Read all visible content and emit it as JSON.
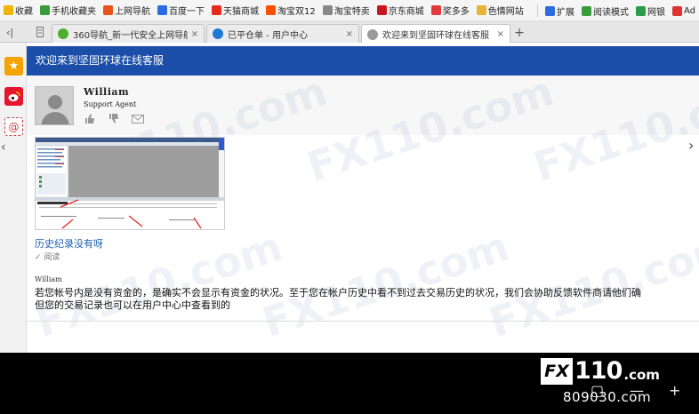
{
  "bookmarks": [
    {
      "label": "收藏",
      "icon": "star-icon",
      "color": "#f0b400"
    },
    {
      "label": "手机收藏夹",
      "icon": "phone-icon",
      "color": "#3a9b3a"
    },
    {
      "label": "上网导航",
      "icon": "nav-icon",
      "color": "#e8531a"
    },
    {
      "label": "百度一下",
      "icon": "baidu-icon",
      "color": "#2d6be0"
    },
    {
      "label": "天猫商城",
      "icon": "tmall-icon",
      "color": "#e62b1e"
    },
    {
      "label": "淘宝双12",
      "icon": "taobao-icon",
      "color": "#ff5000"
    },
    {
      "label": "淘宝特卖",
      "icon": "page-icon",
      "color": "#888888"
    },
    {
      "label": "京东商城",
      "icon": "jd-icon",
      "color": "#c91623"
    },
    {
      "label": "奖多多",
      "icon": "gift-icon",
      "color": "#e23a3a"
    },
    {
      "label": "色情网站",
      "icon": "folder-icon",
      "color": "#e8b339"
    }
  ],
  "bookmarks_more": "»",
  "toolbar_right": [
    {
      "label": "扩展",
      "icon": "grid-icon",
      "color": "#2d6be0"
    },
    {
      "label": "阅读模式",
      "icon": "book-icon",
      "color": "#3a9b3a"
    },
    {
      "label": "网银",
      "icon": "bank-icon",
      "color": "#2d9b4a"
    },
    {
      "label": "Ad",
      "icon": "ad-icon",
      "color": "#d33"
    }
  ],
  "tabs": [
    {
      "title": "360导航_新一代安全上网导航",
      "icon": "360-icon",
      "color": "#4cae2a",
      "active": false
    },
    {
      "title": "已平仓单 - 用户中心",
      "icon": "refresh-icon",
      "color": "#1f7ad6",
      "active": false
    },
    {
      "title": "欢迎来到坚固环球在线客服",
      "icon": "page-icon",
      "color": "#9a9a9a",
      "active": true
    }
  ],
  "tab_close": "×",
  "tab_add": "+",
  "tab_back": "‹|",
  "page": {
    "header_title": "欢迎来到坚固环球在线客服",
    "agent_name": "William",
    "agent_role": "Support Agent",
    "message_title": "历史纪录没有呀",
    "read_status": "✓ 阅读",
    "reply_author": "William",
    "reply_lines": [
      "若您帐号内是没有资金的，是确实不会显示有资金的状况。至于您在帐户历史中看不到过去交易历史的状况，我们会协助反馈软件商请他们确",
      "但您的交易记录也可以在用户中心中查看到的"
    ]
  },
  "watermark_text": "FX110.com",
  "footer": {
    "logo_fx": "FX",
    "logo_num": "110",
    "logo_com": ".com",
    "site": "809030.com"
  },
  "colors": {
    "header_bg": "#1a4ea8",
    "link": "#1a5fb0"
  }
}
